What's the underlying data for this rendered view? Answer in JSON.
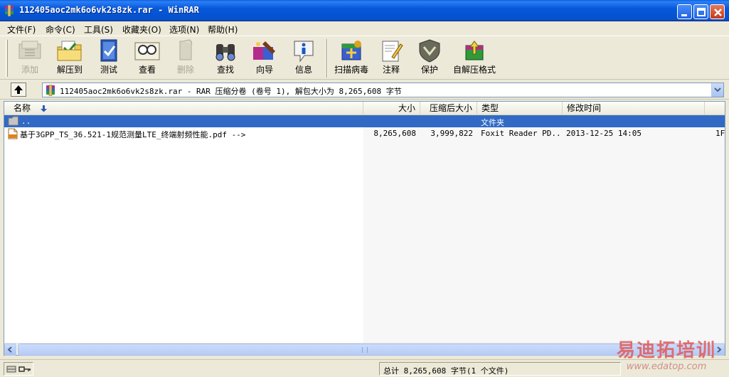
{
  "window": {
    "title": "112405aoc2mk6o6vk2s8zk.rar - WinRAR"
  },
  "menu": [
    {
      "label": "文件(F)"
    },
    {
      "label": "命令(C)"
    },
    {
      "label": "工具(S)"
    },
    {
      "label": "收藏夹(O)"
    },
    {
      "label": "选项(N)"
    },
    {
      "label": "帮助(H)"
    }
  ],
  "toolbar": {
    "add": "添加",
    "extract_to": "解压到",
    "test": "测试",
    "view": "查看",
    "delete": "删除",
    "find": "查找",
    "wizard": "向导",
    "info": "信息",
    "virus_scan": "扫描病毒",
    "comment": "注释",
    "protect": "保护",
    "sfx": "自解压格式"
  },
  "address": {
    "path": "112405aoc2mk6o6vk2s8zk.rar - RAR 压缩分卷 (卷号 1), 解包大小为 8,265,608 字节"
  },
  "columns": {
    "name": "名称",
    "size": "大小",
    "packed": "压缩后大小",
    "type": "类型",
    "modified": "修改时间"
  },
  "files": [
    {
      "name": "..",
      "size": "",
      "packed": "",
      "type": "文件夹",
      "modified": "",
      "extra": ""
    },
    {
      "name": "基于3GPP_TS_36.521-1规范测量LTE_终端射频性能.pdf -->",
      "size": "8,265,608",
      "packed": "3,999,822",
      "type": "Foxit Reader PD...",
      "modified": "2013-12-25 14:05",
      "extra": "1F"
    }
  ],
  "status": {
    "summary": "总计 8,265,608 字节(1 个文件)"
  },
  "watermark": {
    "cn": "易迪拓培训",
    "url": "www.edatop.com"
  },
  "colors": {
    "titlebar": "#0758db",
    "selection": "#316ac5",
    "face": "#ece9d8"
  }
}
